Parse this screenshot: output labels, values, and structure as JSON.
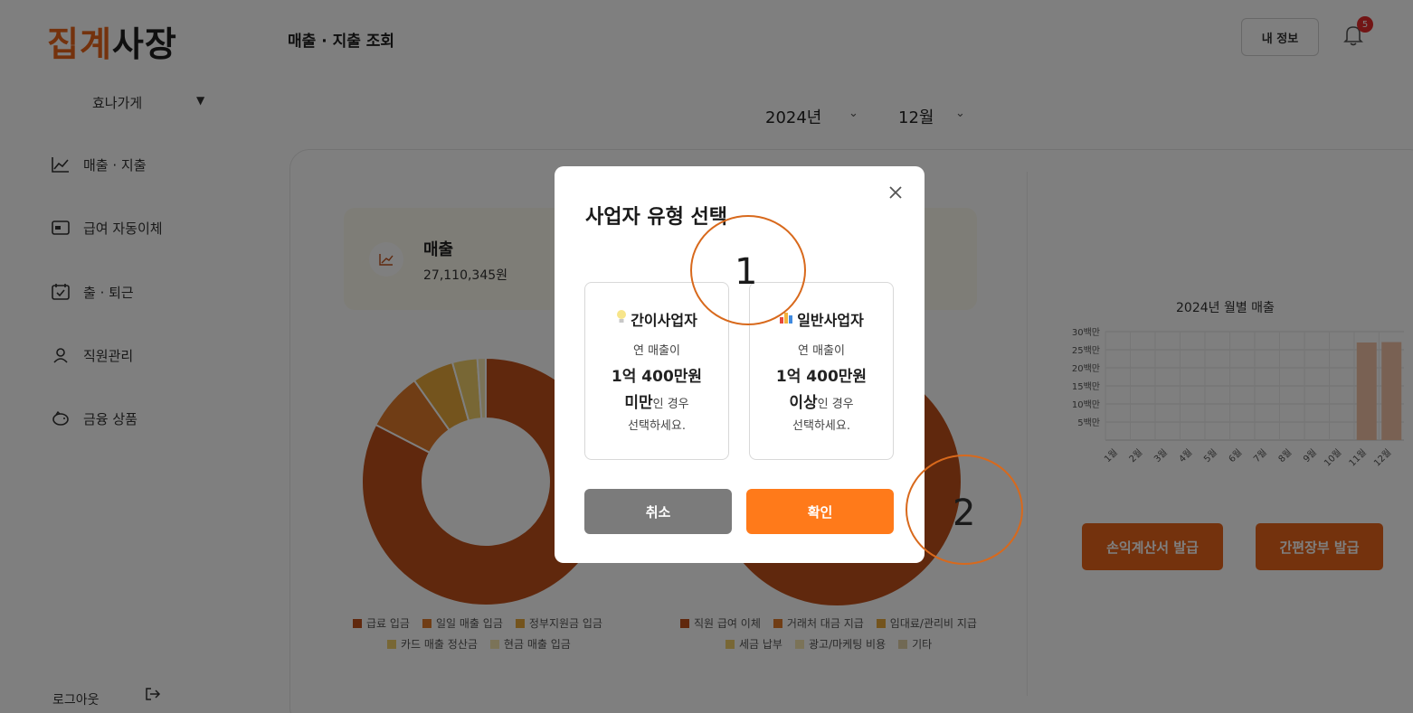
{
  "brand": {
    "logo_part1": "집계",
    "logo_part2": "사장",
    "accent_color": "#e8651a"
  },
  "sidebar": {
    "store_name": "효나가게",
    "store_caret": "▼",
    "items": [
      {
        "label": "매출 · 지출",
        "icon": "line-chart-icon"
      },
      {
        "label": "급여 자동이체",
        "icon": "payment-card-icon"
      },
      {
        "label": "출 · 퇴근",
        "icon": "calendar-check-icon"
      },
      {
        "label": "직원관리",
        "icon": "person-icon"
      },
      {
        "label": "금융 상품",
        "icon": "piggy-bank-icon"
      }
    ],
    "logout_label": "로그아웃"
  },
  "header": {
    "page_title": "매출 · 지출 조회",
    "my_info_label": "내 정보",
    "notification_count": "5"
  },
  "filters": {
    "year": "2024년",
    "month": "12월"
  },
  "summary": {
    "label": "매출",
    "value": "27,110,345원"
  },
  "income_legend": {
    "row1": [
      "급료 입금",
      "일일 매출 입금",
      "정부지원금 입금"
    ],
    "row2": [
      "카드 매출 정산금",
      "현금 매출 입금"
    ]
  },
  "expense_legend": {
    "row1": [
      "직원 급여 이체",
      "거래처 대금 지급",
      "임대료/관리비 지급"
    ],
    "row2": [
      "세금 납부",
      "광고/마케팅 비용",
      "기타"
    ]
  },
  "legend_colors": [
    "#c0501a",
    "#e07a2a",
    "#e8a93a",
    "#f0cf6a",
    "#f6e6b0",
    "#e2d3a8"
  ],
  "chart_data": [
    {
      "type": "pie",
      "title": "",
      "labels": [
        "급료 입금",
        "일일 매출 입금",
        "정부지원금 입금",
        "카드 매출 정산금",
        "현금 매출 입금"
      ],
      "values": [
        76,
        7,
        5,
        3,
        1
      ]
    },
    {
      "type": "bar",
      "title": "2024년 월별 매출",
      "categories": [
        "1월",
        "2월",
        "3월",
        "4월",
        "5월",
        "6월",
        "7월",
        "8월",
        "9월",
        "10월",
        "11월",
        "12월"
      ],
      "values": [
        0,
        0,
        0,
        0,
        0,
        0,
        0,
        0,
        0,
        0,
        27000000,
        27110345
      ],
      "y_tick_labels": [
        "30백만",
        "25백만",
        "20백만",
        "15백만",
        "10백만",
        "5백만"
      ],
      "ylim": [
        0,
        30000000
      ],
      "grid": true
    }
  ],
  "actions": {
    "pl_statement": "손익계산서 발급",
    "simple_ledger": "간편장부 발급"
  },
  "modal": {
    "title": "사업자 유형 선택",
    "close_icon": "close-icon",
    "simple": {
      "icon": "lightbulb-icon",
      "title": "간이사업자",
      "line1": "연 매출이",
      "amount": "1억 400만원",
      "cond_bold": "미만",
      "cond_rest": "인 경우",
      "select": "선택하세요."
    },
    "general": {
      "icon": "bar-chart-icon",
      "title": "일반사업자",
      "line1": "연 매출이",
      "amount": "1억 400만원",
      "cond_bold": "이상",
      "cond_rest": "인 경우",
      "select": "선택하세요."
    },
    "cancel_label": "취소",
    "confirm_label": "확인"
  },
  "annotations": {
    "marker1": "1",
    "marker2": "2",
    "marker_color": "#d8691c"
  }
}
